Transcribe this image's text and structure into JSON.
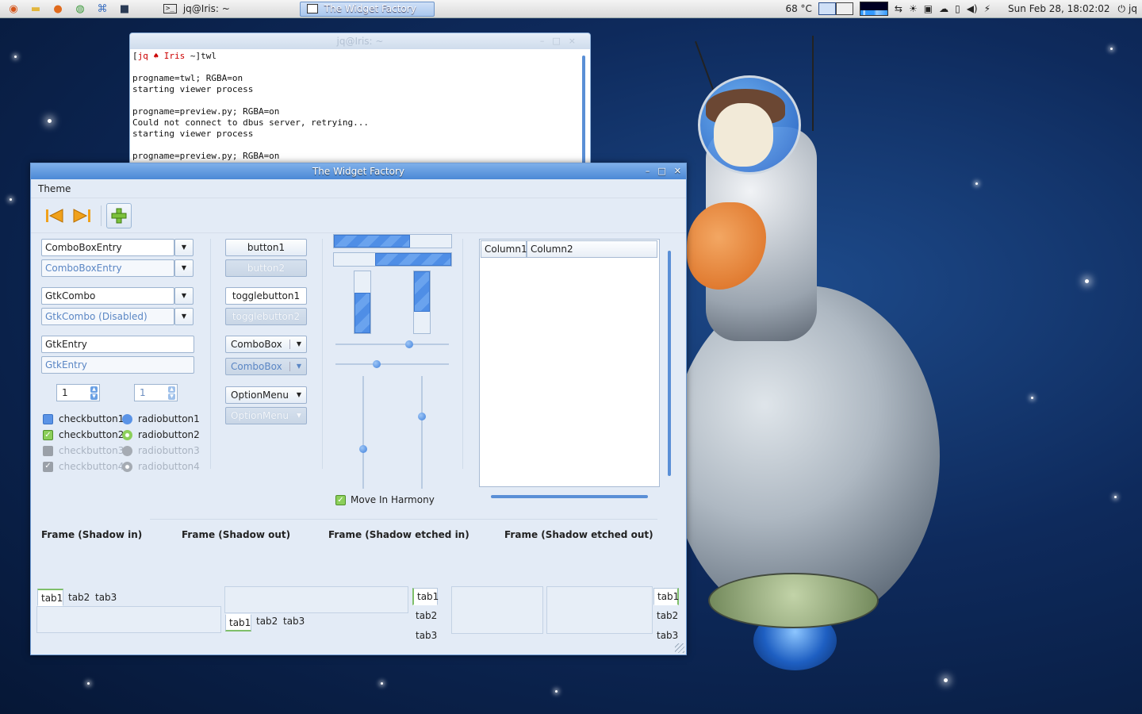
{
  "panel": {
    "tasks": [
      {
        "label": "jq@Iris: ~",
        "active": false
      },
      {
        "label": "The Widget Factory",
        "active": true
      }
    ],
    "temperature": "68 °C",
    "clock": "Sun Feb 28, 18:02:02",
    "user": "jq"
  },
  "terminal": {
    "title": "jq@Iris: ~",
    "prompt_user": "jq",
    "prompt_host": "Iris",
    "prompt_path": "~",
    "prompt_cmd": "twl",
    "lines": [
      "",
      "progname=twl; RGBA=on",
      "starting viewer process",
      "",
      "progname=preview.py; RGBA=on",
      "Could not connect to dbus server, retrying...",
      "starting viewer process",
      "",
      "progname=preview.py; RGBA=on"
    ]
  },
  "window": {
    "title": "The Widget Factory",
    "menu": [
      "Theme"
    ],
    "col1": {
      "combo_entry": "ComboBoxEntry",
      "combo_entry_dis": "ComboBoxEntry",
      "gtkcombo": "GtkCombo",
      "gtkcombo_dis": "GtkCombo (Disabled)",
      "entry": "GtkEntry",
      "entry_dis": "GtkEntry",
      "spin1": "1",
      "spin2": "1",
      "checks": [
        "checkbutton1",
        "checkbutton2",
        "checkbutton3",
        "checkbutton4"
      ],
      "radios": [
        "radiobutton1",
        "radiobutton2",
        "radiobutton3",
        "radiobutton4"
      ]
    },
    "col2": {
      "button1": "button1",
      "button2": "button2",
      "toggle1": "togglebutton1",
      "toggle2": "togglebutton2",
      "combobox": "ComboBox",
      "combobox_dis": "ComboBox",
      "optionmenu": "OptionMenu",
      "optionmenu_dis": "OptionMenu"
    },
    "col3": {
      "progress_h1": 0.65,
      "progress_h2": 0.65,
      "progress_v1": 0.65,
      "progress_v2": 0.65,
      "move_in_harmony": "Move In Harmony"
    },
    "tree": {
      "columns": [
        "Column1",
        "Column2"
      ]
    },
    "frames": [
      "Frame (Shadow in)",
      "Frame (Shadow out)",
      "Frame (Shadow etched in)",
      "Frame (Shadow etched out)"
    ],
    "tabs": [
      "tab1",
      "tab2",
      "tab3"
    ]
  }
}
